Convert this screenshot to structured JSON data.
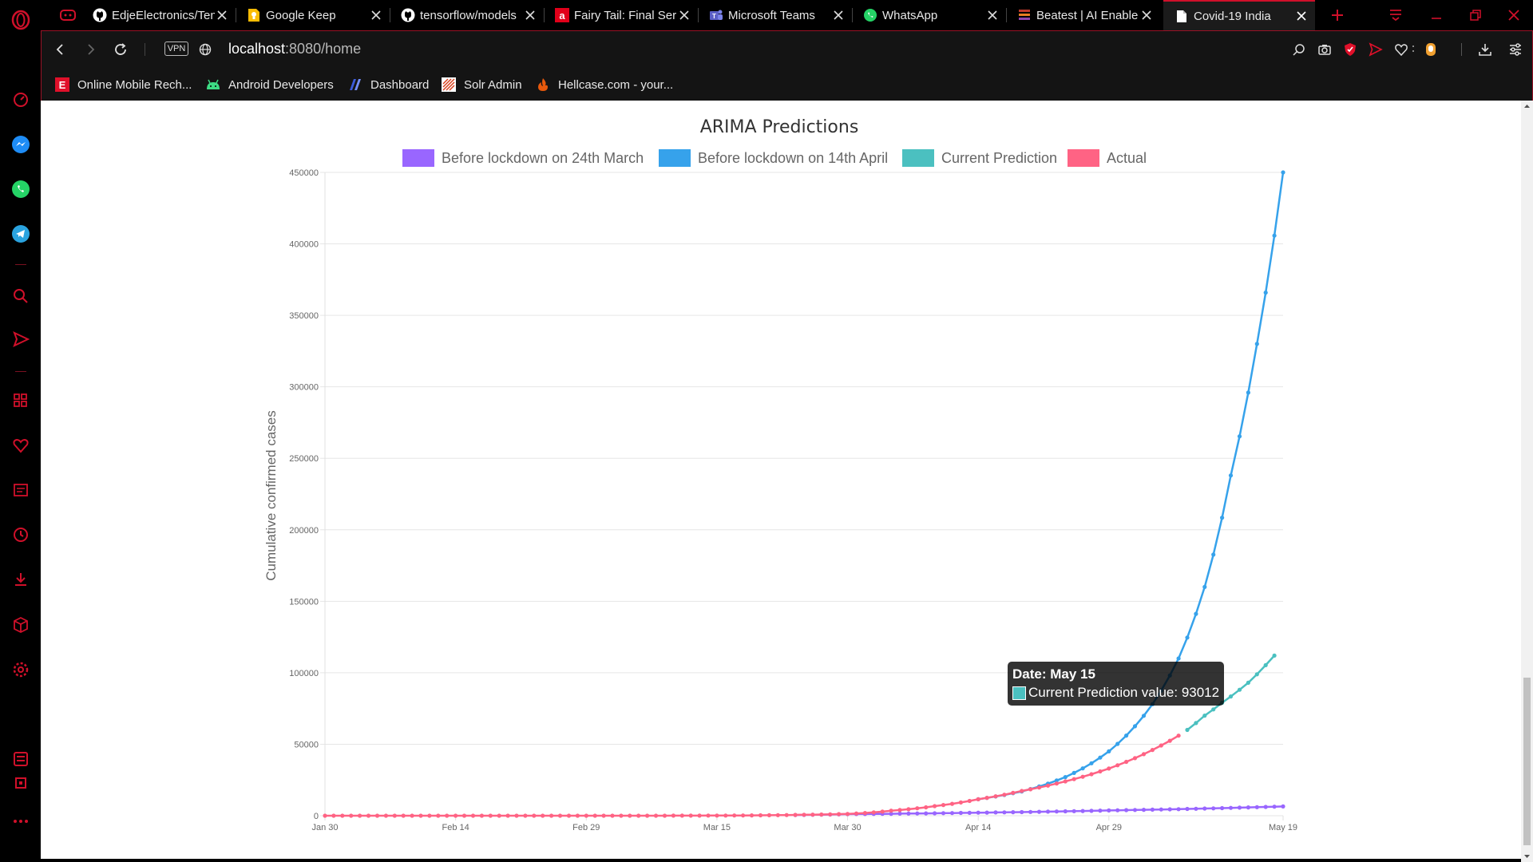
{
  "browser": {
    "tabs": [
      {
        "title": "EdjeElectronics/Ten",
        "icon": "github-icon"
      },
      {
        "title": "Google Keep",
        "icon": "keep-icon"
      },
      {
        "title": "tensorflow/models",
        "icon": "github-icon"
      },
      {
        "title": "Fairy Tail: Final Seri",
        "icon": "anime-icon"
      },
      {
        "title": "Microsoft Teams",
        "icon": "teams-icon"
      },
      {
        "title": "WhatsApp",
        "icon": "whatsapp-icon"
      },
      {
        "title": "Beatest | AI Enable",
        "icon": "beatest-icon"
      },
      {
        "title": "Covid-19 India",
        "icon": "document-icon",
        "active": true
      }
    ],
    "vpn_label": "VPN",
    "url_host": "localhost",
    "url_rest": ":8080/home",
    "bookmarks": [
      {
        "label": "Online Mobile Rech...",
        "icon": "e-icon"
      },
      {
        "label": "Android Developers",
        "icon": "android-icon"
      },
      {
        "label": "Dashboard",
        "icon": "dashboard-icon"
      },
      {
        "label": "Solr Admin",
        "icon": "solr-icon"
      },
      {
        "label": "Hellcase.com - your...",
        "icon": "hellcase-icon"
      }
    ],
    "accent_color": "#d0102a"
  },
  "tooltip": {
    "title": "Date: May 15",
    "label": "Current Prediction value: 93012"
  },
  "chart_data": {
    "type": "line",
    "title": "ARIMA Predictions",
    "ylabel": "Cumulative confirmed cases",
    "xlabel": "",
    "x_ticks": [
      "Jan 30",
      "Feb 14",
      "Feb 29",
      "Mar 15",
      "Mar 30",
      "Apr 14",
      "Apr 29",
      "May 19"
    ],
    "x_range": [
      "Jan 30",
      "May 19"
    ],
    "y_ticks": [
      0,
      50000,
      100000,
      150000,
      200000,
      250000,
      300000,
      350000,
      400000,
      450000
    ],
    "ylim": [
      0,
      450000
    ],
    "grid": true,
    "legend_position": "top",
    "series": [
      {
        "name": "Before lockdown on 24th March",
        "color": "#9966ff",
        "points": [
          [
            "Mar 24",
            500
          ],
          [
            "Mar 30",
            1100
          ],
          [
            "Apr 14",
            2100
          ],
          [
            "Apr 29",
            3700
          ],
          [
            "May 10",
            5000
          ],
          [
            "May 19",
            6500
          ]
        ]
      },
      {
        "name": "Before lockdown on 14th April",
        "color": "#36a2eb",
        "points": [
          [
            "Apr 14",
            11500
          ],
          [
            "Apr 19",
            17000
          ],
          [
            "Apr 24",
            27000
          ],
          [
            "Apr 29",
            45000
          ],
          [
            "May 4",
            78000
          ],
          [
            "May 7",
            110000
          ],
          [
            "May 10",
            160000
          ],
          [
            "May 13",
            238000
          ],
          [
            "May 16",
            330000
          ],
          [
            "May 19",
            450000
          ]
        ]
      },
      {
        "name": "Current Prediction",
        "color": "#4bc0c0",
        "points": [
          [
            "May 8",
            60000
          ],
          [
            "May 10",
            70000
          ],
          [
            "May 12",
            79000
          ],
          [
            "May 15",
            93012
          ],
          [
            "May 18",
            112000
          ]
        ]
      },
      {
        "name": "Actual",
        "color": "#ff6384",
        "points": [
          [
            "Jan 30",
            0
          ],
          [
            "Mar 1",
            3
          ],
          [
            "Mar 15",
            110
          ],
          [
            "Mar 25",
            650
          ],
          [
            "Mar 30",
            1250
          ],
          [
            "Apr 4",
            3500
          ],
          [
            "Apr 9",
            6700
          ],
          [
            "Apr 14",
            11500
          ],
          [
            "Apr 19",
            17300
          ],
          [
            "Apr 24",
            24000
          ],
          [
            "Apr 29",
            33000
          ],
          [
            "May 4",
            46000
          ],
          [
            "May 7",
            56000
          ]
        ]
      }
    ]
  }
}
